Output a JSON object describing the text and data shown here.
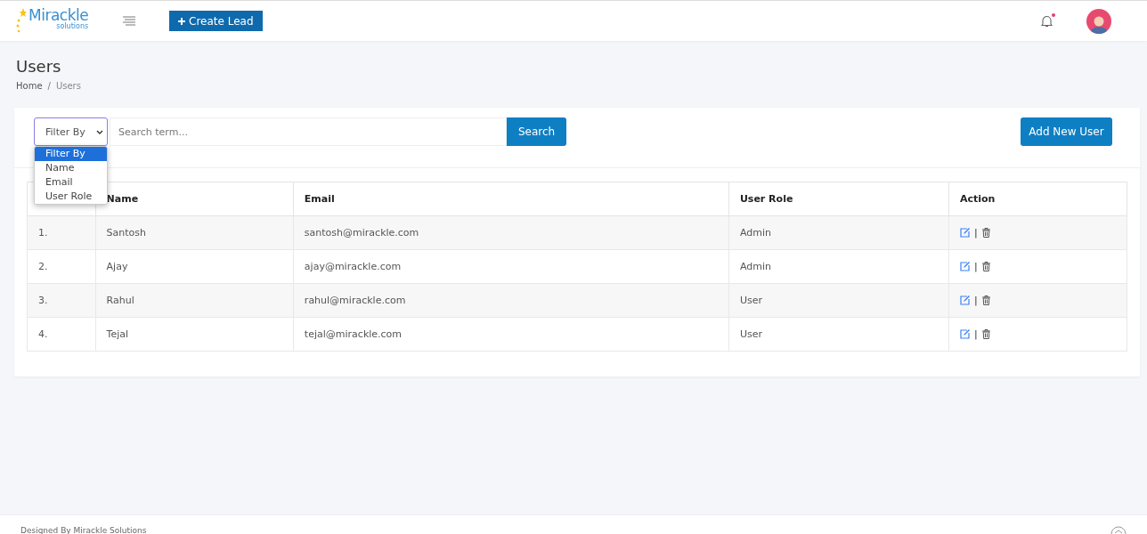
{
  "header": {
    "logo_text": "Mirackle",
    "logo_sub": "solutions",
    "create_button": "Create Lead",
    "notification_dot": true
  },
  "page": {
    "title": "Users",
    "breadcrumb": [
      {
        "label": "Home",
        "current": false
      },
      {
        "label": "Users",
        "current": true
      }
    ],
    "breadcrumb_separator": "/"
  },
  "toolbar": {
    "filter": {
      "value": "Filter By",
      "open": true,
      "options": [
        {
          "label": "Filter By",
          "selected": true
        },
        {
          "label": "Name",
          "selected": false
        },
        {
          "label": "Email",
          "selected": false
        },
        {
          "label": "User Role",
          "selected": false
        }
      ]
    },
    "search": {
      "placeholder": "Search term..."
    },
    "search_button": "Search",
    "add_button": "Add New User"
  },
  "table": {
    "columns": [
      "Name",
      "Email",
      "User Role",
      "Action"
    ],
    "rows": [
      {
        "index": "1.",
        "name": "Santosh",
        "email": "santosh@mirackle.com",
        "role": "Admin",
        "separator": "|"
      },
      {
        "index": "2.",
        "name": "Ajay",
        "email": "ajay@mirackle.com",
        "role": "Admin",
        "separator": "|"
      },
      {
        "index": "3.",
        "name": "Rahul",
        "email": "rahul@mirackle.com",
        "role": "User",
        "separator": "|"
      },
      {
        "index": "4.",
        "name": "Tejal",
        "email": "tejal@mirackle.com",
        "role": "User",
        "separator": "|"
      }
    ]
  },
  "footer": {
    "text": "Designed By Mirackle Solutions"
  }
}
